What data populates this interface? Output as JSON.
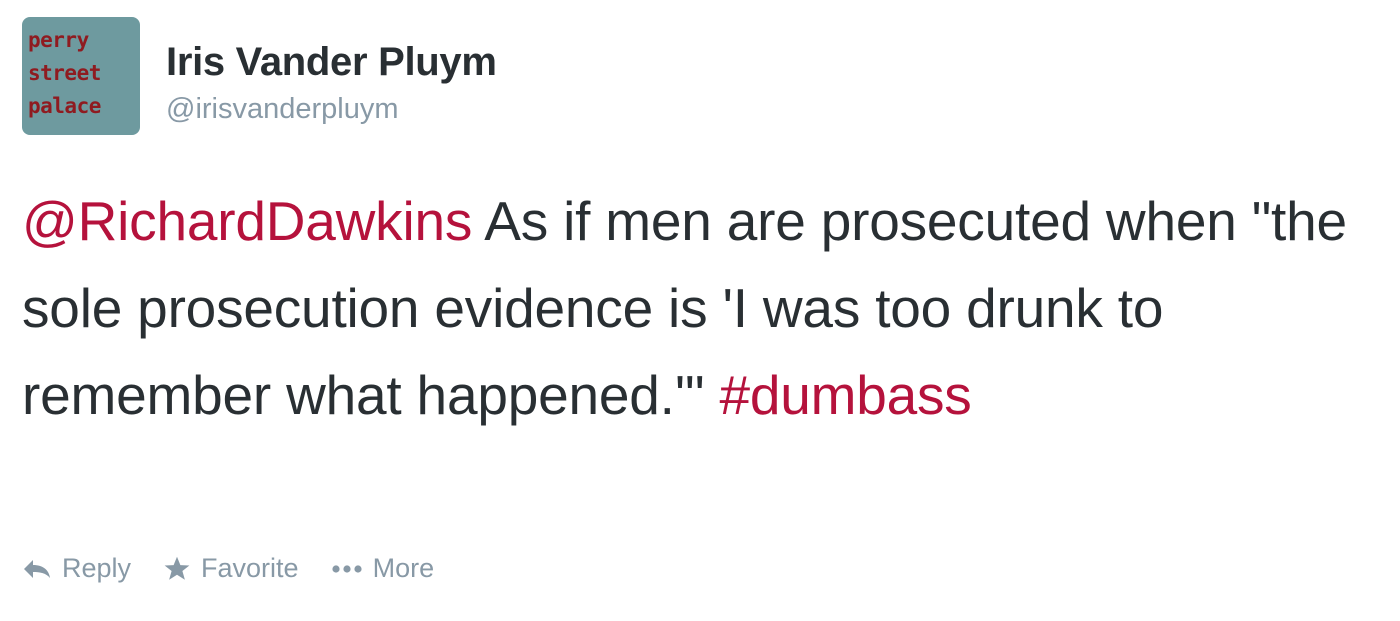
{
  "tweet": {
    "avatar": {
      "lines": [
        "perry",
        "street",
        "palace"
      ]
    },
    "author": {
      "display_name": "Iris Vander Pluym",
      "handle": "@irisvanderpluym"
    },
    "body": {
      "mention": "@RichardDawkins",
      "text": " As if men are prosecuted when \"the sole prosecution evidence is 'I was too drunk to remember what happened.'\" ",
      "hashtag": "#dumbass"
    },
    "actions": {
      "reply_label": "Reply",
      "favorite_label": "Favorite",
      "more_label": "More"
    }
  },
  "colors": {
    "link": "#b5123c",
    "text": "#292f33",
    "muted": "#8899a6",
    "avatar_bg": "#6e9a9f",
    "avatar_text": "#8f1b20"
  },
  "icons": {
    "reply": "reply-arrow-icon",
    "favorite": "star-icon",
    "more": "ellipsis-icon"
  }
}
